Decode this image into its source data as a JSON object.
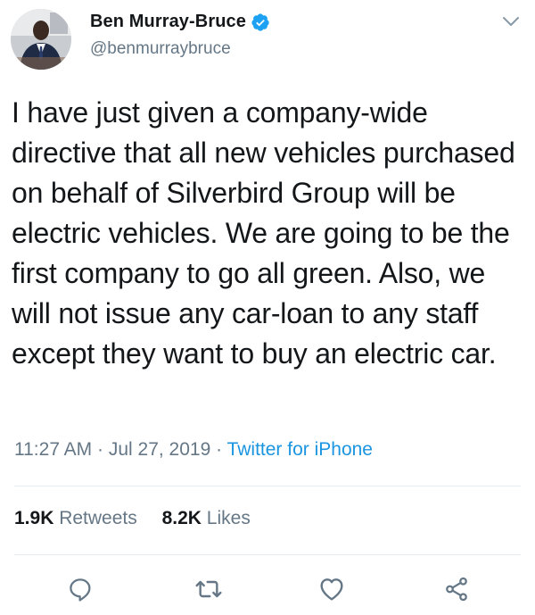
{
  "author": {
    "display_name": "Ben Murray-Bruce",
    "handle": "@benmurraybruce",
    "verified": true,
    "avatar_icon": "profile-photo"
  },
  "tweet": {
    "text": "I have just given a company-wide directive that all new vehicles purchased on behalf of Silverbird Group will be electric vehicles. We are going to be the first company to go all green. Also, we will not issue any car-loan to any staff except they want to buy an electric car.",
    "time": "11:27 AM",
    "date": "Jul 27, 2019",
    "source": "Twitter for iPhone"
  },
  "stats": {
    "retweets_count": "1.9K",
    "retweets_label": "Retweets",
    "likes_count": "8.2K",
    "likes_label": "Likes"
  },
  "actions": {
    "reply_icon": "reply-icon",
    "retweet_icon": "retweet-icon",
    "like_icon": "heart-icon",
    "share_icon": "share-icon"
  },
  "colors": {
    "text": "#14171a",
    "secondary": "#657786",
    "link": "#1b95e0",
    "divider": "#e6ecf0",
    "verified": "#1da1f2"
  }
}
